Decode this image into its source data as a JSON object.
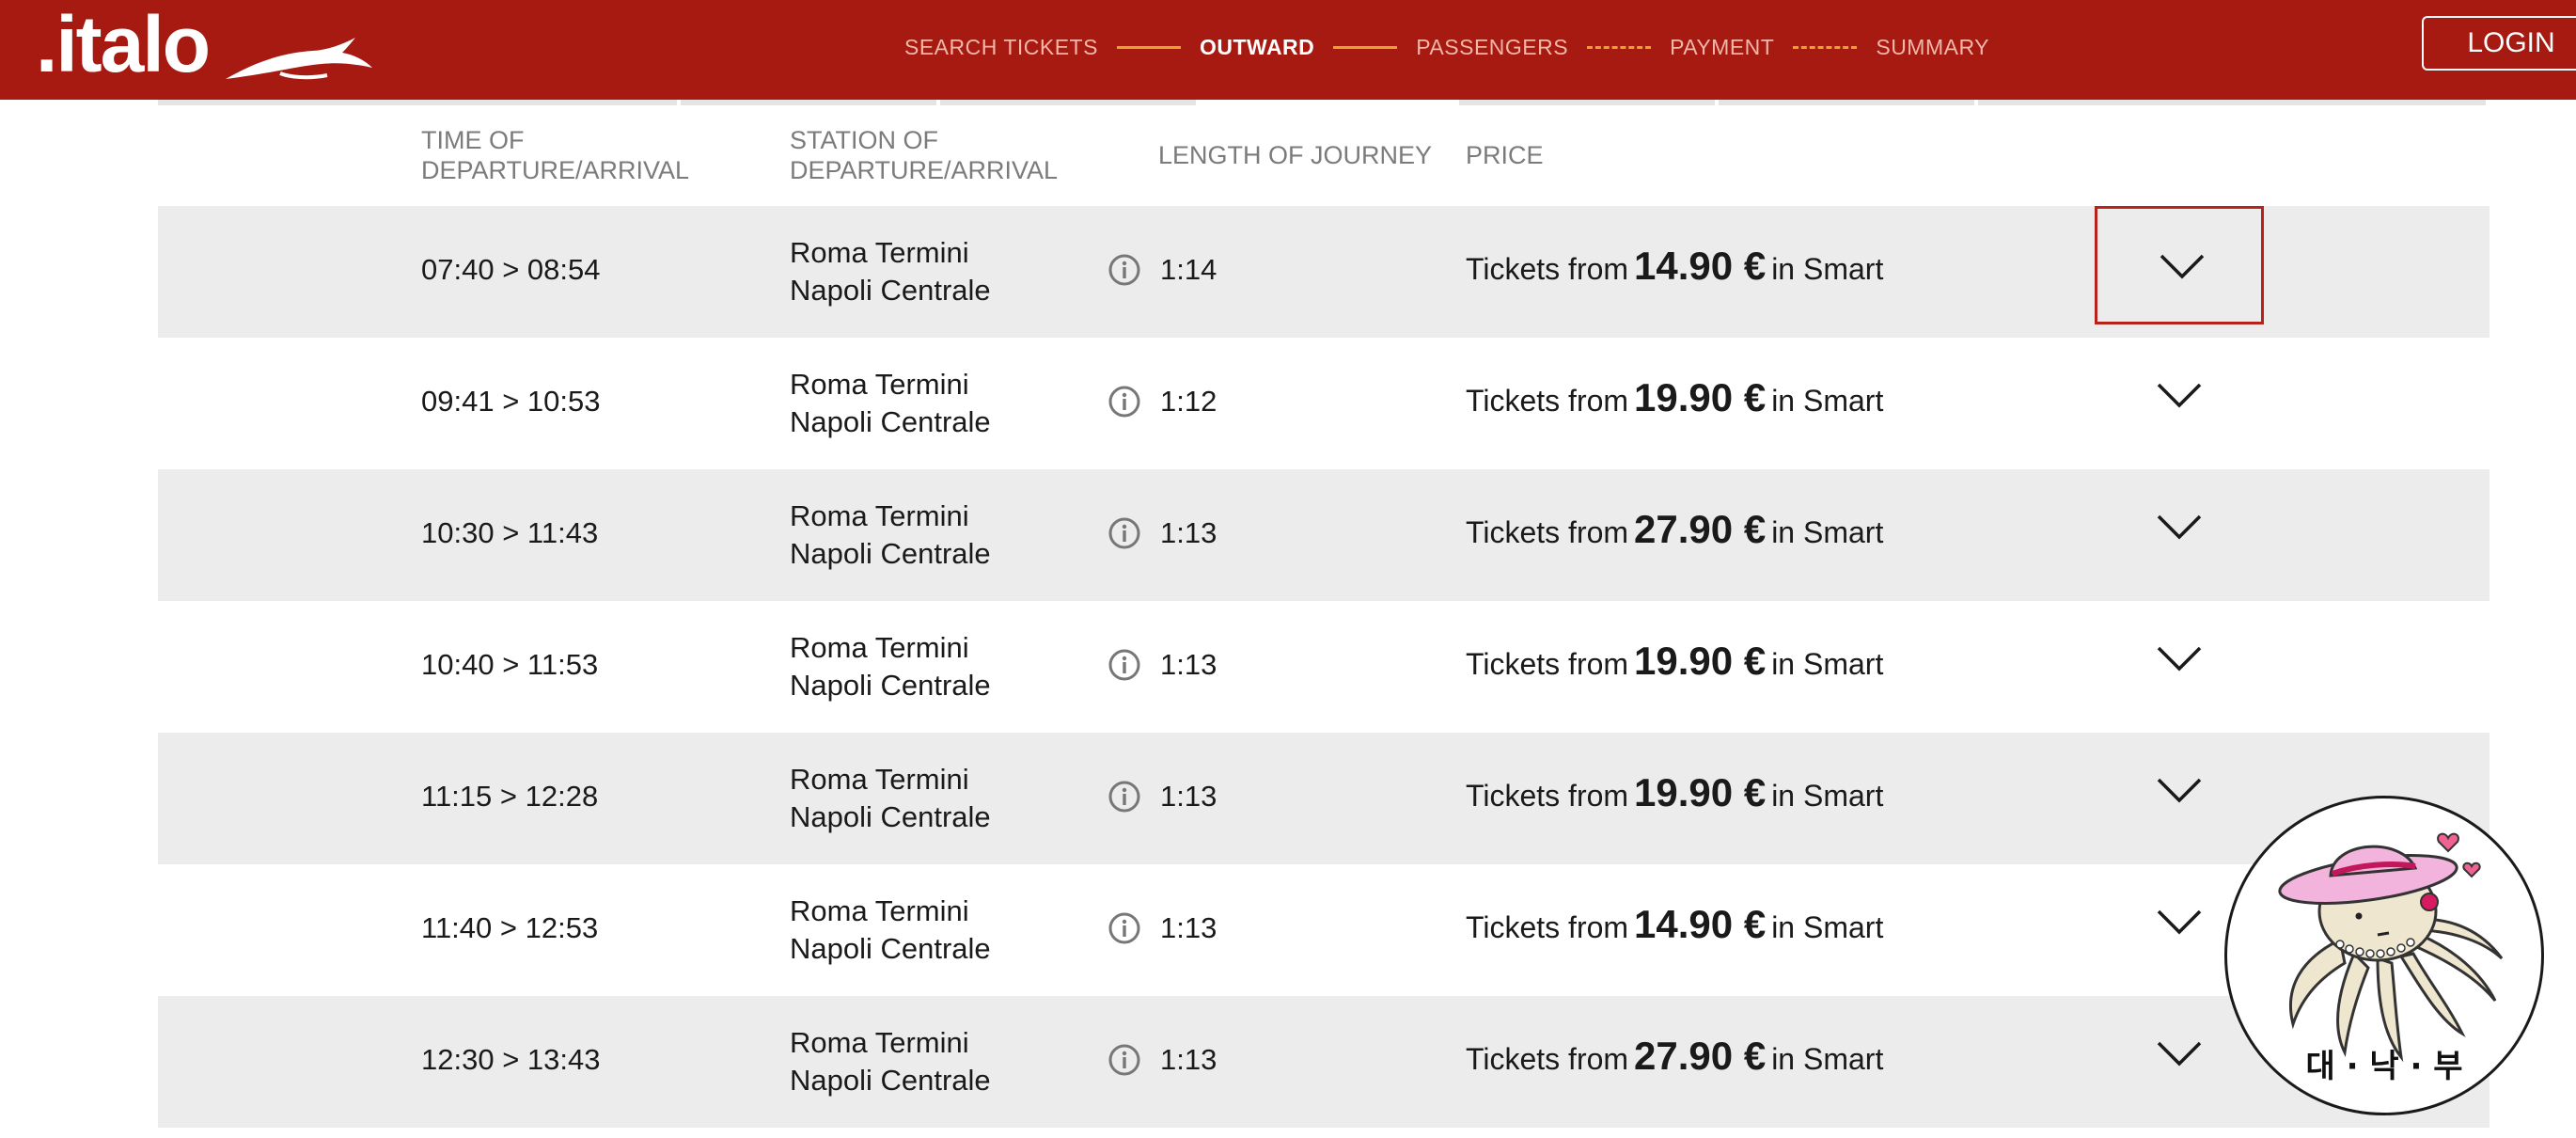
{
  "header": {
    "logo_text": ".italo",
    "steps": [
      {
        "label": "SEARCH TICKETS",
        "active": false
      },
      {
        "label": "OUTWARD",
        "active": true
      },
      {
        "label": "PASSENGERS",
        "active": false
      },
      {
        "label": "PAYMENT",
        "active": false
      },
      {
        "label": "SUMMARY",
        "active": false
      }
    ],
    "login_label": "LOGIN"
  },
  "columns": {
    "time": [
      "TIME OF",
      "DEPARTURE/ARRIVAL"
    ],
    "station": [
      "STATION OF",
      "DEPARTURE/ARRIVAL"
    ],
    "length": "LENGTH OF JOURNEY",
    "price": "PRICE"
  },
  "labels": {
    "tickets_from": "Tickets from",
    "in_smart": "in Smart"
  },
  "trains": [
    {
      "time": "07:40 > 08:54",
      "from": "Roma Termini",
      "to": "Napoli Centrale",
      "duration": "1:14",
      "price": "14.90 €"
    },
    {
      "time": "09:41 > 10:53",
      "from": "Roma Termini",
      "to": "Napoli Centrale",
      "duration": "1:12",
      "price": "19.90 €"
    },
    {
      "time": "10:30 > 11:43",
      "from": "Roma Termini",
      "to": "Napoli Centrale",
      "duration": "1:13",
      "price": "27.90 €"
    },
    {
      "time": "10:40 > 11:53",
      "from": "Roma Termini",
      "to": "Napoli Centrale",
      "duration": "1:13",
      "price": "19.90 €"
    },
    {
      "time": "11:15 > 12:28",
      "from": "Roma Termini",
      "to": "Napoli Centrale",
      "duration": "1:13",
      "price": "19.90 €"
    },
    {
      "time": "11:40 > 12:53",
      "from": "Roma Termini",
      "to": "Napoli Centrale",
      "duration": "1:13",
      "price": "14.90 €"
    },
    {
      "time": "12:30 > 13:43",
      "from": "Roma Termini",
      "to": "Napoli Centrale",
      "duration": "1:13",
      "price": "27.90 €"
    }
  ],
  "selected_row": 0,
  "sticker": {
    "text": "대 · 낙 · 부"
  },
  "colors": {
    "brand_red": "#a61a11",
    "step_line": "#e3a52c",
    "row_shade": "#ececec",
    "selected_border": "#b5231b"
  }
}
